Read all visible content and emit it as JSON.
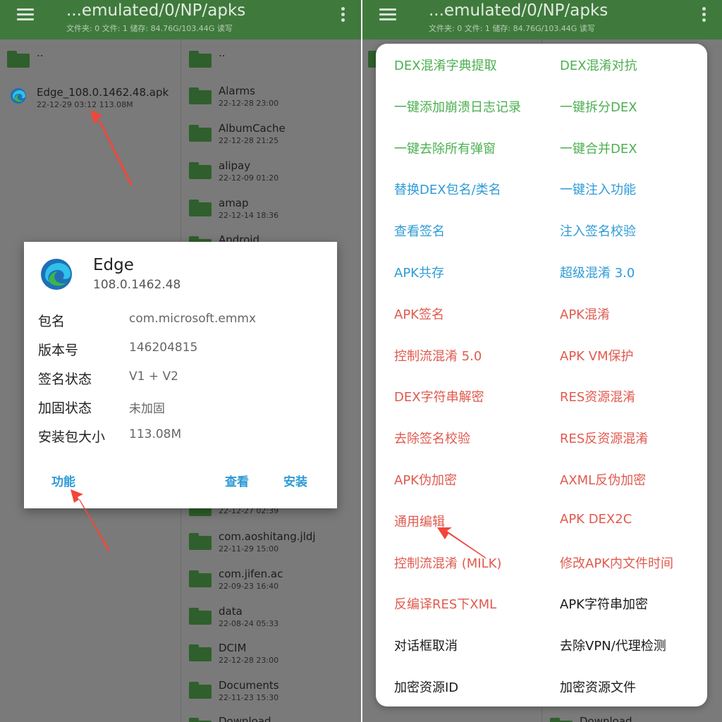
{
  "colors": {
    "appbar": "#3f7a3c",
    "green": "#4caf50",
    "blue": "#2e9bd6",
    "red": "#e05a4f",
    "black": "#1a1a1a",
    "arrow": "#f0473a"
  },
  "left": {
    "toolbar": {
      "title": "...emulated/0/NP/apks",
      "subtitle": "文件夹: 0 文件: 1 储存: 84.76G/103.44G 读写"
    },
    "files": [
      {
        "name": "..",
        "meta": "",
        "icon": "folder-icon"
      },
      {
        "name": "Edge_108.0.1462.48.apk",
        "meta": "22-12-29 03:12 113.08M",
        "icon": "edge-icon"
      }
    ]
  },
  "middle": {
    "folders": [
      {
        "name": "..",
        "meta": ""
      },
      {
        "name": "Alarms",
        "meta": "22-12-28 23:00"
      },
      {
        "name": "AlbumCache",
        "meta": "22-12-28 21:25"
      },
      {
        "name": "alipay",
        "meta": "22-12-09 01:20"
      },
      {
        "name": "amap",
        "meta": "22-12-14 18:36"
      },
      {
        "name": "Android",
        "meta": ""
      }
    ],
    "folders_lower": [
      {
        "name": "",
        "meta": "22-12-27 02:39"
      },
      {
        "name": "com.aoshitang.jldj",
        "meta": "22-11-29 15:00"
      },
      {
        "name": "com.jifen.ac",
        "meta": "22-09-23 16:40"
      },
      {
        "name": "data",
        "meta": "22-08-24 05:33"
      },
      {
        "name": "DCIM",
        "meta": "22-12-28 23:00"
      },
      {
        "name": "Documents",
        "meta": "22-11-23 15:30"
      },
      {
        "name": "Download",
        "meta": ""
      }
    ]
  },
  "right": {
    "toolbar": {
      "title": "...emulated/0/NP/apks",
      "subtitle": "文件夹: 0 文件: 1 储存: 84.76G/103.44G 读写"
    },
    "bottom_folder": "Download"
  },
  "dialog": {
    "app_name": "Edge",
    "app_version": "108.0.1462.48",
    "rows": [
      {
        "key": "包名",
        "value": "com.microsoft.emmx"
      },
      {
        "key": "版本号",
        "value": "146204815"
      },
      {
        "key": "签名状态",
        "value": "V1 + V2"
      },
      {
        "key": "加固状态",
        "value": "未加固"
      },
      {
        "key": "安装包大小",
        "value": "113.08M"
      }
    ],
    "buttons": {
      "function": "功能",
      "view": "查看",
      "install": "安装"
    }
  },
  "function_menu": {
    "left_column": [
      {
        "label": "DEX混淆字典提取",
        "color": "green"
      },
      {
        "label": "一键添加崩溃日志记录",
        "color": "green"
      },
      {
        "label": "一键去除所有弹窗",
        "color": "green"
      },
      {
        "label": "替换DEX包名/类名",
        "color": "blue"
      },
      {
        "label": "查看签名",
        "color": "blue"
      },
      {
        "label": "APK共存",
        "color": "blue"
      },
      {
        "label": "APK签名",
        "color": "red"
      },
      {
        "label": "控制流混淆 5.0",
        "color": "red"
      },
      {
        "label": "DEX字符串解密",
        "color": "red"
      },
      {
        "label": "去除签名校验",
        "color": "red"
      },
      {
        "label": "APK伪加密",
        "color": "red"
      },
      {
        "label": "通用编辑",
        "color": "red"
      },
      {
        "label": "控制流混淆 (MILK)",
        "color": "red"
      },
      {
        "label": "反编译RES下XML",
        "color": "red"
      },
      {
        "label": "对话框取消",
        "color": "black"
      },
      {
        "label": "加密资源ID",
        "color": "black"
      }
    ],
    "right_column": [
      {
        "label": "DEX混淆对抗",
        "color": "green"
      },
      {
        "label": "一键拆分DEX",
        "color": "green"
      },
      {
        "label": "一键合并DEX",
        "color": "green"
      },
      {
        "label": "一键注入功能",
        "color": "blue"
      },
      {
        "label": "注入签名校验",
        "color": "blue"
      },
      {
        "label": "超级混淆 3.0",
        "color": "blue"
      },
      {
        "label": "APK混淆",
        "color": "red"
      },
      {
        "label": "APK VM保护",
        "color": "red"
      },
      {
        "label": "RES资源混淆",
        "color": "red"
      },
      {
        "label": "RES反资源混淆",
        "color": "red"
      },
      {
        "label": "AXML反伪加密",
        "color": "red"
      },
      {
        "label": "APK DEX2C",
        "color": "red"
      },
      {
        "label": "修改APK内文件时间",
        "color": "red"
      },
      {
        "label": "APK字符串加密",
        "color": "black"
      },
      {
        "label": "去除VPN/代理检测",
        "color": "black"
      },
      {
        "label": "加密资源文件",
        "color": "black"
      }
    ]
  }
}
